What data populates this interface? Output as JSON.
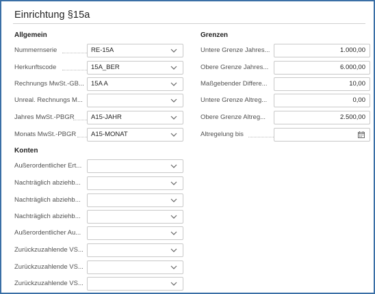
{
  "page": {
    "title": "Einrichtung §15a"
  },
  "allgemein": {
    "title": "Allgemein",
    "fields": [
      {
        "caption": "Nummernserie",
        "value": "RE-15A"
      },
      {
        "caption": "Herkunftscode",
        "value": "15A_BER"
      },
      {
        "caption": "Rechnungs MwSt.-GB...",
        "value": "15A A"
      },
      {
        "caption": "Unreal. Rechnungs M...",
        "value": ""
      },
      {
        "caption": "Jahres MwSt.-PBGR",
        "value": "A15-JAHR"
      },
      {
        "caption": "Monats MwSt.-PBGR",
        "value": "A15-MONAT"
      }
    ]
  },
  "konten": {
    "title": "Konten",
    "fields": [
      {
        "caption": "Außerordentlicher Ert...",
        "value": ""
      },
      {
        "caption": "Nachträglich abziehb...",
        "value": ""
      },
      {
        "caption": "Nachträglich abziehb...",
        "value": ""
      },
      {
        "caption": "Nachträglich abziehb...",
        "value": ""
      },
      {
        "caption": "Außerordentlicher Au...",
        "value": ""
      },
      {
        "caption": "Zurückzuzahlende VS...",
        "value": ""
      },
      {
        "caption": "Zurückzuzahlende VS...",
        "value": ""
      },
      {
        "caption": "Zurückzuzahlende VS...",
        "value": ""
      }
    ]
  },
  "grenzen": {
    "title": "Grenzen",
    "fields": [
      {
        "caption": "Untere Grenze Jahres...",
        "value": "1.000,00"
      },
      {
        "caption": "Obere Grenze Jahres...",
        "value": "6.000,00"
      },
      {
        "caption": "Maßgebender Differe...",
        "value": "10,00"
      },
      {
        "caption": "Untere Grenze Altreg...",
        "value": "0,00"
      },
      {
        "caption": "Obere Grenze Altreg...",
        "value": "2.500,00"
      },
      {
        "caption": "Altregelung bis",
        "value": ""
      }
    ]
  },
  "icons": {
    "dropdown": "chevron-down-icon",
    "date": "calendar-icon"
  }
}
